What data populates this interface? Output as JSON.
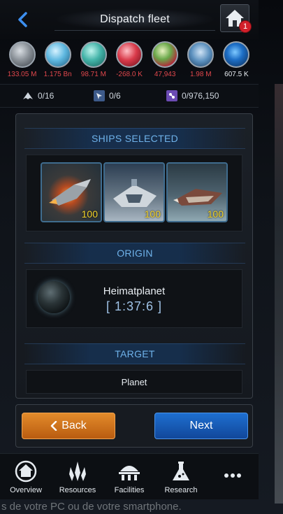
{
  "header": {
    "title": "Dispatch fleet",
    "home_badge": "1"
  },
  "resources": [
    {
      "icon": "metal-icon",
      "value": "133.05 M",
      "color": "#e0474c"
    },
    {
      "icon": "crystal-icon",
      "value": "1.175 Bn",
      "color": "#e0474c"
    },
    {
      "icon": "deuterium-icon",
      "value": "98.71 M",
      "color": "#e0474c"
    },
    {
      "icon": "energy-icon",
      "value": "-268.0 K",
      "color": "#e0474c"
    },
    {
      "icon": "food-icon",
      "value": "47,943",
      "color": "#e0474c"
    },
    {
      "icon": "population-icon",
      "value": "1.98 M",
      "color": "#e0474c"
    },
    {
      "icon": "dark-matter-icon",
      "value": "607.5 K",
      "color": "#e6ebf0"
    }
  ],
  "counters": {
    "fleet_slots": "0/16",
    "expedition_slots": "0/6",
    "cargo": "0/976,150"
  },
  "sections": {
    "ships_selected": "SHIPS SELECTED",
    "origin": "ORIGIN",
    "target": "TARGET"
  },
  "ships": [
    {
      "qty": "100"
    },
    {
      "qty": "100"
    },
    {
      "qty": "100"
    }
  ],
  "origin": {
    "name": "Heimatplanet",
    "coords": "[ 1:37:6 ]"
  },
  "target": {
    "type": "Planet"
  },
  "buttons": {
    "back": "Back",
    "next": "Next"
  },
  "nav": [
    {
      "label": "Overview",
      "icon": "overview-planet-icon"
    },
    {
      "label": "Resources",
      "icon": "resources-crystal-icon"
    },
    {
      "label": "Facilities",
      "icon": "facilities-building-icon"
    },
    {
      "label": "Research",
      "icon": "research-flask-icon"
    },
    {
      "label": "",
      "icon": "more-icon"
    }
  ],
  "background_text": "s de votre PC ou de votre smartphone."
}
